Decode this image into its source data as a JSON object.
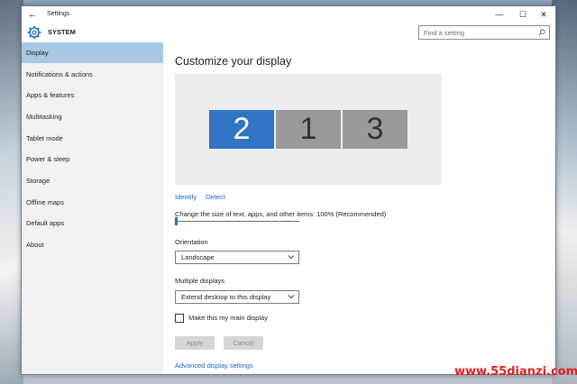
{
  "window": {
    "title": "Settings",
    "back_icon": "back-arrow-icon",
    "minimize_glyph": "—",
    "maximize_glyph": "☐",
    "close_glyph": "✕"
  },
  "header": {
    "section": "SYSTEM",
    "search_placeholder": "Find a setting"
  },
  "sidebar": {
    "items": [
      {
        "label": "Display",
        "active": true
      },
      {
        "label": "Notifications & actions"
      },
      {
        "label": "Apps & features"
      },
      {
        "label": "Multitasking"
      },
      {
        "label": "Tablet mode"
      },
      {
        "label": "Power & sleep"
      },
      {
        "label": "Storage"
      },
      {
        "label": "Offline maps"
      },
      {
        "label": "Default apps"
      },
      {
        "label": "About"
      }
    ]
  },
  "main": {
    "title": "Customize your display",
    "monitors": [
      {
        "label": "2",
        "selected": true
      },
      {
        "label": "1"
      },
      {
        "label": "3"
      }
    ],
    "identify_label": "Identify",
    "detect_label": "Detect",
    "scale_label": "Change the size of text, apps, and other items: 100% (Recommended)",
    "scale_value_percent": 0,
    "orientation_label": "Orientation",
    "orientation_value": "Landscape",
    "multiple_displays_label": "Multiple displays",
    "multiple_displays_value": "Extend desktop to this display",
    "main_display_label": "Make this my main display",
    "main_display_checked": false,
    "apply_label": "Apply",
    "cancel_label": "Cancel",
    "advanced_label": "Advanced display settings"
  },
  "colors": {
    "accent": "#3173c5",
    "nav_active": "#a9c8e6",
    "link": "#1f66c1"
  },
  "watermark": "www.55dianzi.com"
}
